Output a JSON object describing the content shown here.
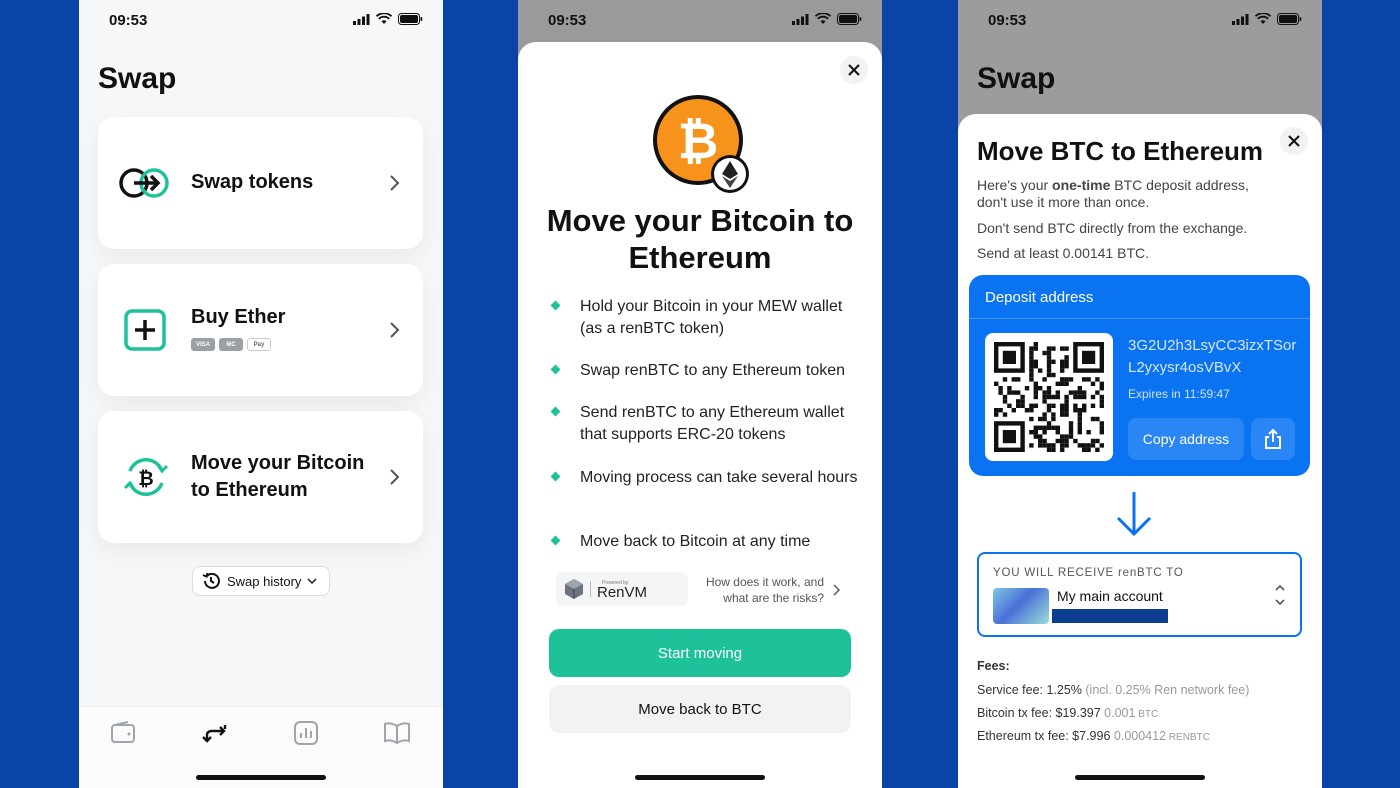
{
  "status_time": "09:53",
  "screen1": {
    "title": "Swap",
    "cards": [
      {
        "label": "Swap tokens"
      },
      {
        "label": "Buy Ether",
        "badges": [
          "VISA",
          "MC",
          "Pay"
        ]
      },
      {
        "label_line1": "Move your Bitcoin",
        "label_line2": "to Ethereum"
      }
    ],
    "history_label": "Swap history",
    "tabs": [
      "wallet-icon",
      "swap-icon",
      "chart-icon",
      "book-icon"
    ]
  },
  "screen2": {
    "heading_line1": "Move your Bitcoin to",
    "heading_line2": "Ethereum",
    "bullets": [
      "Hold your Bitcoin in your MEW wallet (as a renBTC token)",
      "Swap renBTC to any Ethereum token",
      "Send renBTC to any Ethereum wallet that supports ERC-20 tokens",
      "Moving process can take several hours",
      "Move back to Bitcoin at any time"
    ],
    "powered_by": "Powered by",
    "renvm": "RenVM",
    "how_line1": "How does it work, and",
    "how_line2": "what are the risks?",
    "start_button": "Start moving",
    "back_button": "Move back to BTC"
  },
  "screen3": {
    "bg_title": "Swap",
    "heading": "Move BTC to Ethereum",
    "desc1_pre": "Here's your ",
    "desc1_bold": "one-time",
    "desc1_post": " BTC deposit address, don't use it more than once.",
    "desc2": "Don't send BTC directly from the exchange.",
    "desc3": "Send at least 0.00141 BTC.",
    "deposit_title": "Deposit address",
    "address": "3G2U2h3LsyCC3izxTSorL2yxysr4osVBvX",
    "expires": "Expires in 11:59:47",
    "copy_button": "Copy address",
    "receive_label": "YOU WILL RECEIVE renBTC TO",
    "account_name": "My main account",
    "fees_title": "Fees:",
    "service_fee_label": "Service fee: 1.25%",
    "service_fee_note": " (incl. 0.25% Ren network fee)",
    "btc_fee_label": "Bitcoin tx fee: $19.397",
    "btc_fee_amt": " 0.001",
    "btc_fee_unit": " BTC",
    "eth_fee_label": "Ethereum tx fee: $7.996",
    "eth_fee_amt": " 0.000412",
    "eth_fee_unit": " RENBTC"
  },
  "colors": {
    "accent_green": "#1EC29A",
    "accent_blue": "#0A73F2",
    "bitcoin_orange": "#F7931A",
    "background": "#0B44A8"
  }
}
